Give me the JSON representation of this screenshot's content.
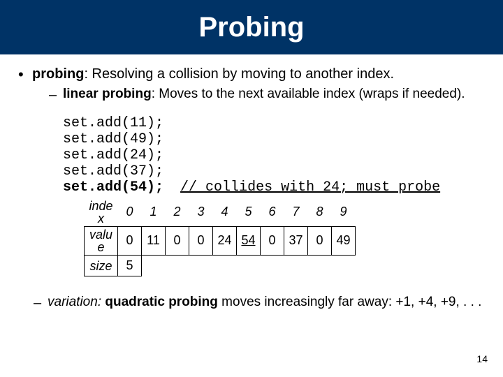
{
  "title": "Probing",
  "bullet1": {
    "term": "probing",
    "rest": ": Resolving a collision by moving to another index."
  },
  "bullet2": {
    "term": "linear probing",
    "rest": ": Moves to the next available index  (wraps if needed)."
  },
  "code": {
    "l1": "set.add(11);",
    "l2": "set.add(49);",
    "l3": "set.add(24);",
    "l4": "set.add(37);",
    "l5_bold": "set.add(54);",
    "l5_comment": "// collides with 24; must probe"
  },
  "table": {
    "index_lbl": "inde\nx",
    "value_lbl": "valu\ne",
    "size_lbl": "size",
    "indices": [
      "0",
      "1",
      "2",
      "3",
      "4",
      "5",
      "6",
      "7",
      "8",
      "9"
    ],
    "values": [
      "0",
      "11",
      "0",
      "0",
      "24",
      "54",
      "0",
      "37",
      "0",
      "49"
    ],
    "size_val": "5"
  },
  "variation": {
    "em": "variation:",
    "bold": "quadratic probing",
    "rest1": " moves increasingly far away: +1, +4, +9, . . ."
  },
  "pagenum": "14"
}
